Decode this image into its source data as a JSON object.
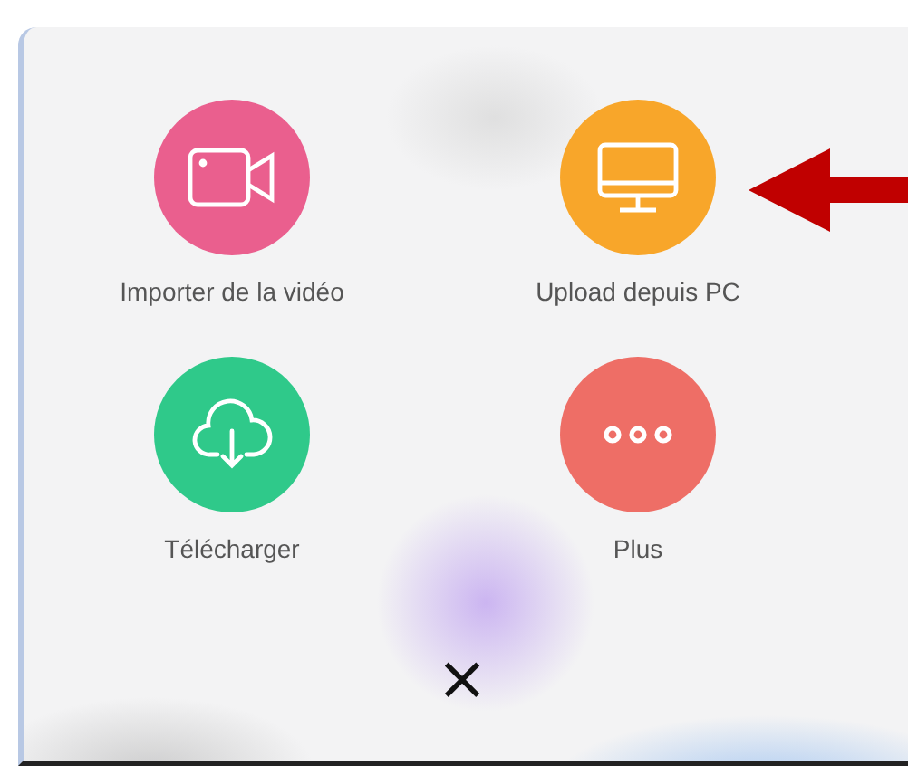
{
  "actions": [
    {
      "kind": "video",
      "label": "Importer de la vidéo",
      "color": "#ea5f8e",
      "annotated": false
    },
    {
      "kind": "monitor",
      "label": "Upload depuis PC",
      "color": "#f8a62a",
      "annotated": true
    },
    {
      "kind": "cloud-download",
      "label": "Télécharger",
      "color": "#2fc98a",
      "annotated": false
    },
    {
      "kind": "more",
      "label": "Plus",
      "color": "#ee6e66",
      "annotated": false
    }
  ],
  "close": {
    "symbol": "×"
  }
}
